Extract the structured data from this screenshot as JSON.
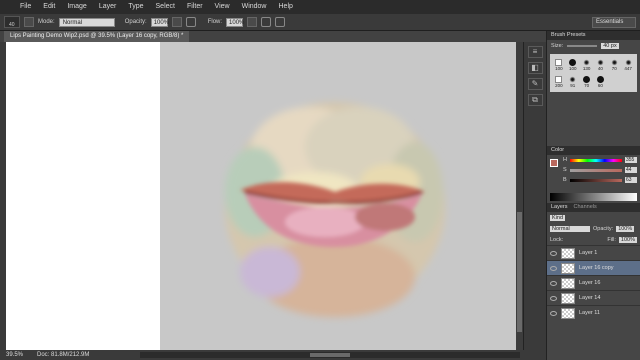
{
  "menubar": {
    "items": [
      "File",
      "Edit",
      "Image",
      "Layer",
      "Type",
      "Select",
      "Filter",
      "View",
      "Window",
      "Help"
    ]
  },
  "options": {
    "brush_size": "40",
    "mode_label": "Mode:",
    "mode_value": "Normal",
    "opacity_label": "Opacity:",
    "opacity_value": "100%",
    "flow_label": "Flow:",
    "flow_value": "100%",
    "workspace": "Essentials"
  },
  "document": {
    "tab_title": "Lips Painting Demo Wip2.psd @ 39.5% (Layer 16 copy, RGB/8) *",
    "zoom": "39.5%",
    "doc_info": "Doc: 81.8M/212.9M"
  },
  "brush_presets": {
    "title": "Brush Presets",
    "size_label": "Size:",
    "size_value": "40 px",
    "brushes": [
      {
        "num": "100",
        "shape": "square"
      },
      {
        "num": "100",
        "shape": "dot"
      },
      {
        "num": "130",
        "shape": "spatter"
      },
      {
        "num": "40",
        "shape": "spatter"
      },
      {
        "num": "70",
        "shape": "spatter"
      },
      {
        "num": "447",
        "shape": "spatter"
      },
      {
        "num": "200",
        "shape": "square"
      },
      {
        "num": "91",
        "shape": "spatter"
      },
      {
        "num": "70",
        "shape": "dot"
      },
      {
        "num": "60",
        "shape": "dot"
      }
    ]
  },
  "color_panel": {
    "title": "Color",
    "h_label": "H",
    "h_value": "355",
    "s_label": "S",
    "s_value": "44",
    "b_label": "B",
    "b_value": "63",
    "fg_color": "#b9685d"
  },
  "layers_panel": {
    "tabs": [
      "Layers",
      "Channels"
    ],
    "kind_label": "Kind",
    "blend_mode": "Normal",
    "opacity_label": "Opacity:",
    "opacity_value": "100%",
    "lock_label": "Lock:",
    "fill_label": "Fill:",
    "fill_value": "100%",
    "layers": [
      {
        "name": "Layer 1",
        "active": false
      },
      {
        "name": "Layer 16 copy",
        "active": true
      },
      {
        "name": "Layer 16",
        "active": false
      },
      {
        "name": "Layer 14",
        "active": false
      },
      {
        "name": "Layer 11",
        "active": false
      }
    ]
  },
  "colors": {
    "ui_dark": "#2b2b2b",
    "panel_bg": "#464646",
    "canvas_gray": "#c8c8c8",
    "active_layer": "#5d6f89"
  }
}
